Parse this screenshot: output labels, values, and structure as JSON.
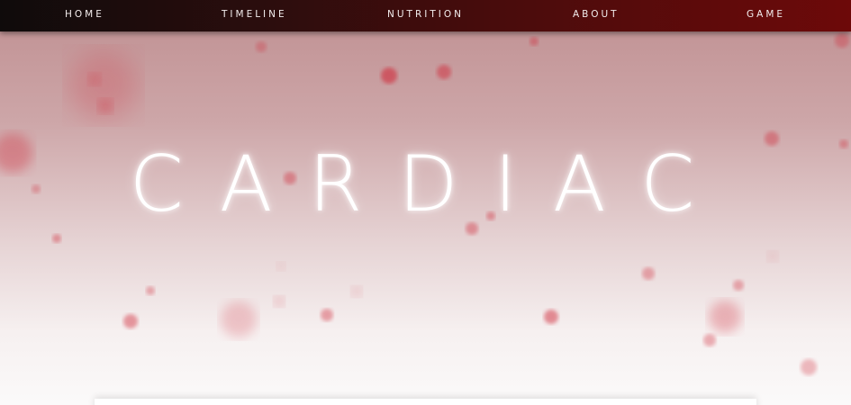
{
  "nav": {
    "home": "HOME",
    "timeline": "TIMELINE",
    "nutrition": "NUTRITION",
    "about": "ABOUT",
    "game": "GAME"
  },
  "hero": {
    "title": "CARDIAC"
  },
  "colors": {
    "nav_start": "#0f0b0b",
    "nav_end": "#6d0909",
    "particle": "#d02a3a"
  },
  "icons": [
    "blood-cell-icon"
  ]
}
